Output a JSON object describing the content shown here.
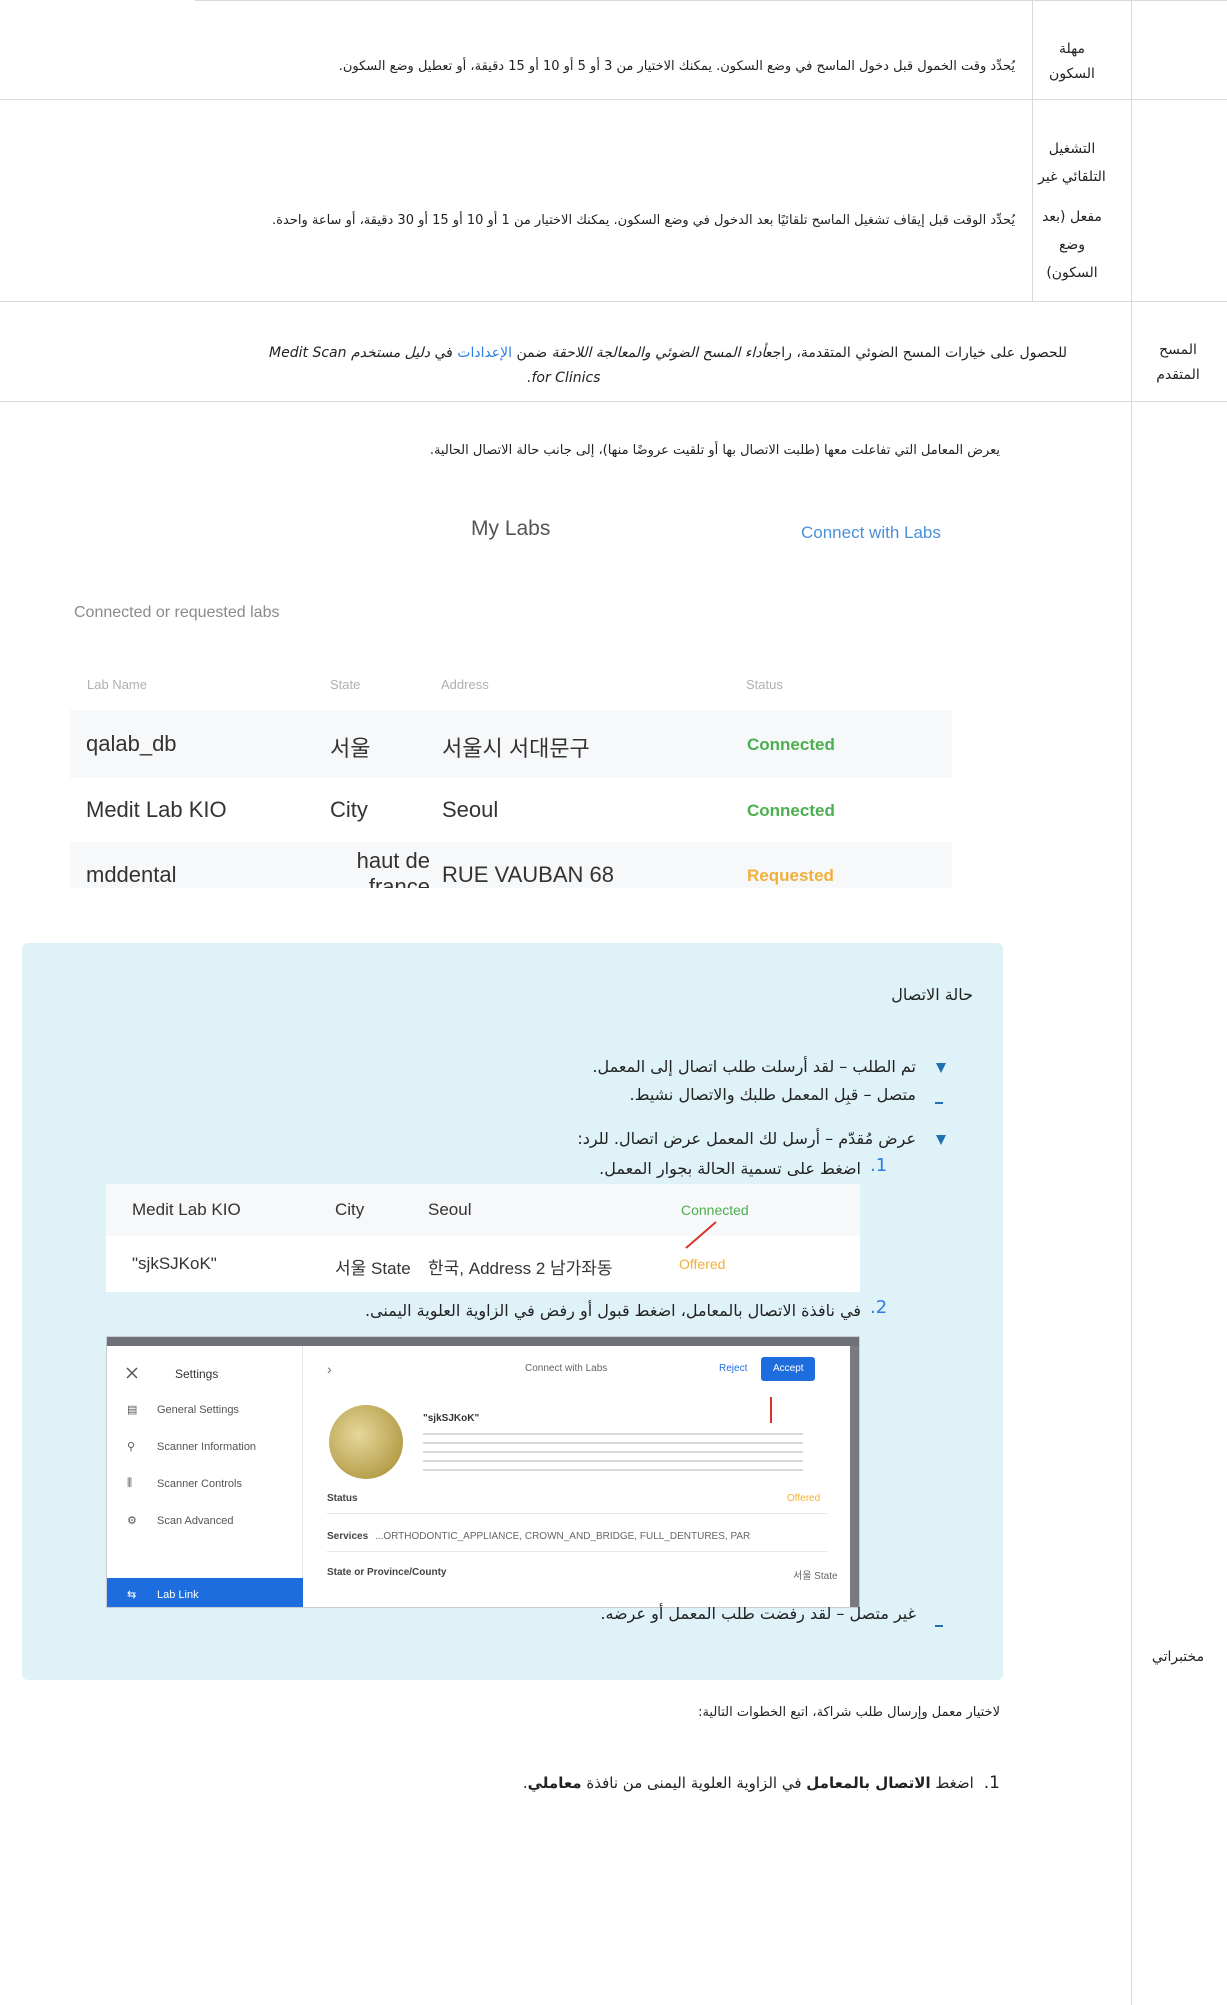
{
  "rows": {
    "sleep_timeout": {
      "label_l1": "مهلة",
      "label_l2": "السكون",
      "description": "يُحدِّد وقت الخمول قبل دخول الماسح في وضع السكون. يمكنك الاختيار من 3 أو 5 أو 10 أو 15 دقيقة، أو تعطيل وضع السكون."
    },
    "auto_off": {
      "label_l1": "التشغيل",
      "label_l2": "التلقائي غير",
      "label_l3": "مفعل (بعد",
      "label_l4": "وضع",
      "label_l5": "السكون)",
      "description": "يُحدِّد الوقت قبل إيقاف تشغيل الماسح تلقائيًا بعد الدخول في وضع السكون. يمكنك الاختيار من 1 أو 10 أو 15 أو 30 دقيقة، أو ساعة واحدة."
    },
    "advanced_scan": {
      "label_l1": "المسح",
      "label_l2": "المتقدم",
      "desc_part1": "للحصول على خيارات المسح الضوئي المتقدمة، راجع",
      "desc_italic1": "أداء المسح الضوئي والمعالجة اللاحقة",
      "desc_part2": " ضمن ",
      "desc_link": "الإعدادات",
      "desc_part3": " في ",
      "desc_italic2": "دليل مستخدم Medit Scan",
      "desc_line2": "for Clinics."
    },
    "my_labs": {
      "label": "مختبراتي",
      "description": "يعرض المعامل التي تفاعلت معها (طلبت الاتصال بها أو تلقيت عروضًا منها)، إلى جانب حالة الاتصال الحالية.",
      "select_intro": "لاختيار معمل وإرسال طلب شراكة، اتبع الخطوات التالية:",
      "step1_num": "1.",
      "step1_pre": "اضغط ",
      "step1_bold": "الاتصال بالمعامل",
      "step1_mid": " في الزاوية العلوية اليمنى من نافذة ",
      "step1_bold2": "معاملي",
      "step1_end": "."
    }
  },
  "my_labs_screenshot": {
    "title": "My Labs",
    "connect_button": "Connect with Labs",
    "section_title": "Connected or requested labs",
    "columns": [
      "Lab Name",
      "State",
      "Address",
      "Status"
    ],
    "rows": [
      {
        "name": "qalab_db",
        "state": "서울",
        "address": "서울시 서대문구",
        "status": "Connected"
      },
      {
        "name": "Medit Lab KIO",
        "state": "City",
        "address": "Seoul",
        "status": "Connected"
      },
      {
        "name": "mddental",
        "state": "haut de france",
        "address": "68 RUE VAUBAN",
        "status": "Requested"
      }
    ]
  },
  "note": {
    "title": "حالة الاتصال",
    "requested": "تم الطلب – لقد أرسلت طلب اتصال إلى المعمل.",
    "connected": "متصل – قبِل المعمل طلبك والاتصال نشيط.",
    "offered": "عرض مُقدّم – أرسل لك المعمل عرض اتصال. للرد:",
    "sub1_num": "1.",
    "sub1": "اضغط على تسمية الحالة بجوار المعمل.",
    "sub2_num": "2.",
    "sub2": "في نافذة الاتصال بالمعامل، اضغط قبول أو رفض في الزاوية العلوية اليمنى.",
    "disconnected": "غير متصل – لقد رفضت طلب المعمل أو عرضه."
  },
  "offered_screenshot": {
    "rows": [
      {
        "name": "Medit Lab KIO",
        "state": "City",
        "address": "Seoul",
        "status": "Connected"
      },
      {
        "name": "\"sjkSJKoK\"",
        "state": "서울 State",
        "address": "한국, Address 2 남가좌동",
        "status": "Offered"
      }
    ]
  },
  "settings_screenshot": {
    "sidebar_title": "Settings",
    "sidebar_items": [
      "General Settings",
      "Scanner Information",
      "Scanner Controls",
      "Scan Advanced",
      "Lab Link"
    ],
    "header": "Connect with Labs",
    "reject": "Reject",
    "accept": "Accept",
    "lab_name": "\"sjkSJKoK\"",
    "status_label": "Status",
    "status_value": "Offered",
    "services_label": "Services",
    "services_value": "ORTHODONTIC_APPLIANCE, CROWN_AND_BRIDGE, FULL_DENTURES, PAR...",
    "state_label": "State or Province/County",
    "state_value": "서울 State"
  },
  "colors": {
    "note_bg": "#dff2f8",
    "link": "#2a7de1",
    "connected": "#4caf50",
    "requested": "#f2b03a",
    "accent_blue": "#1e6ddf"
  }
}
